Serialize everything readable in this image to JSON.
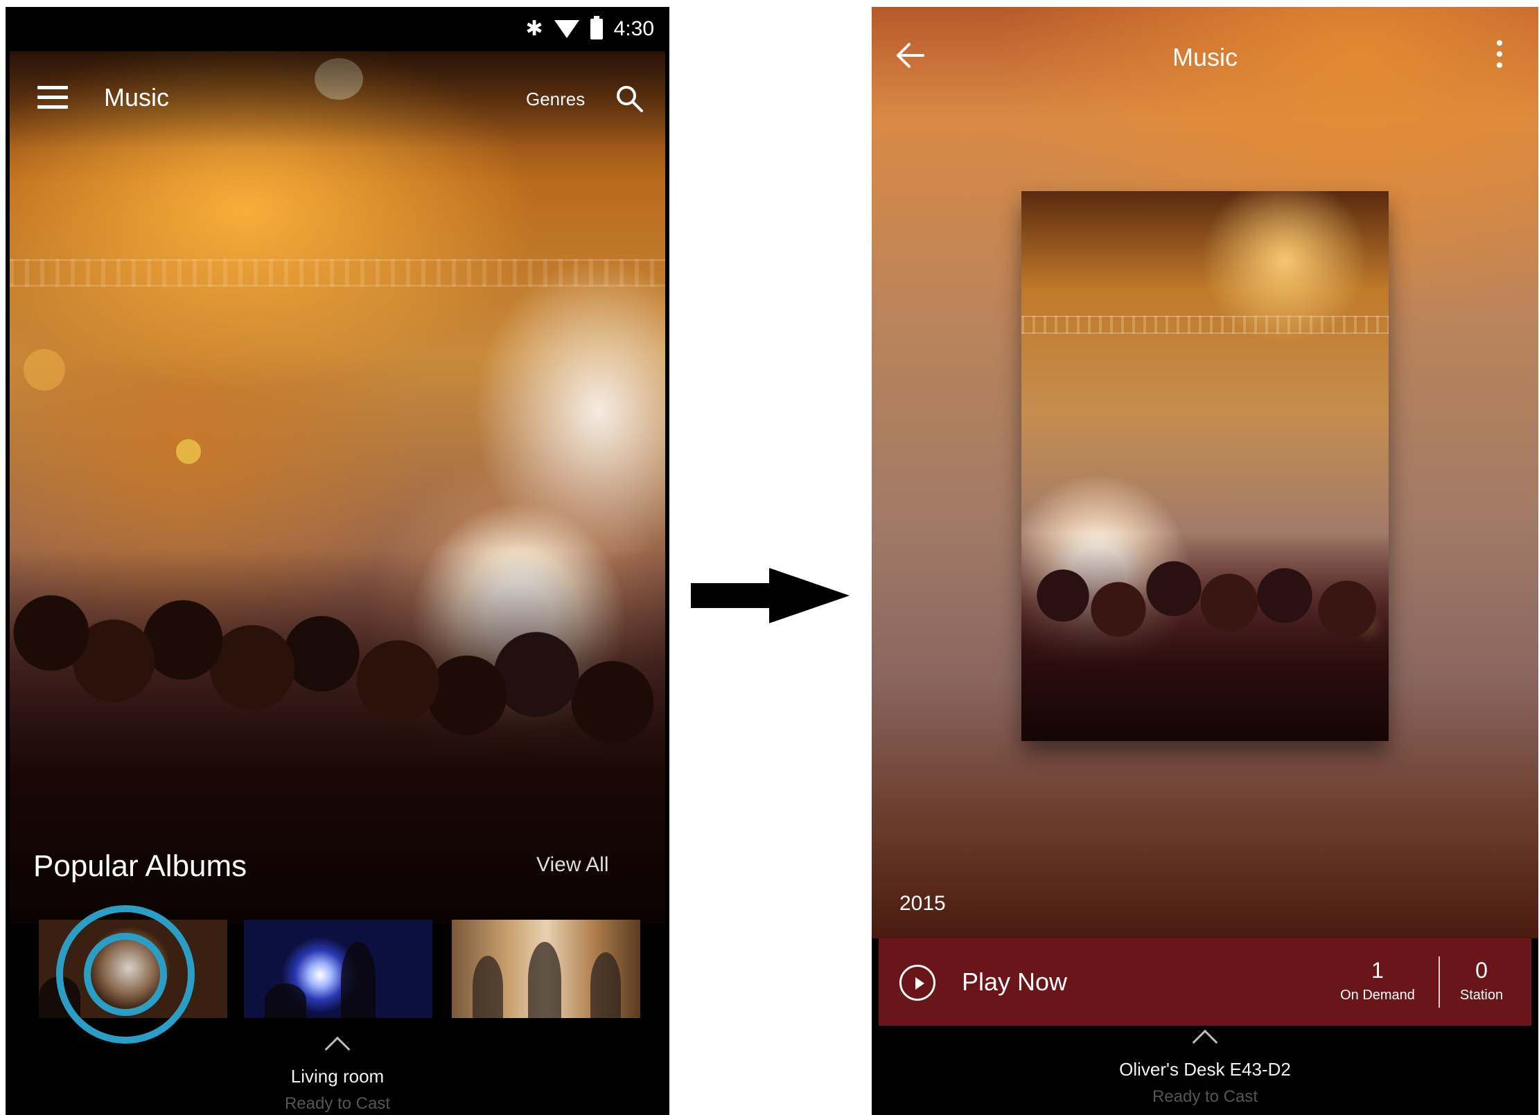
{
  "left_screen": {
    "status_bar": {
      "time": "4:30",
      "icons": [
        "bluetooth-icon",
        "wifi-icon",
        "battery-icon"
      ]
    },
    "app_bar": {
      "title": "Music",
      "genres_label": "Genres",
      "icons": [
        "menu-icon",
        "search-icon"
      ]
    },
    "section": {
      "title": "Popular Albums",
      "view_all_label": "View All"
    },
    "albums_count": 3,
    "cast": {
      "device": "Living room",
      "status": "Ready to Cast"
    }
  },
  "right_screen": {
    "app_bar": {
      "title": "Music",
      "icons": [
        "back-arrow-icon",
        "more-vert-icon"
      ]
    },
    "album": {
      "year": "2015"
    },
    "play_bar": {
      "play_label": "Play Now",
      "on_demand_count": "1",
      "on_demand_label": "On Demand",
      "station_count": "0",
      "station_label": "Station"
    },
    "cast": {
      "device": "Oliver's Desk E43-D2",
      "status": "Ready to Cast"
    }
  },
  "colors": {
    "touch_ring": "#2a9ec4",
    "play_bar_bg": "#6a1519",
    "accent_orange": "#d98a45"
  }
}
